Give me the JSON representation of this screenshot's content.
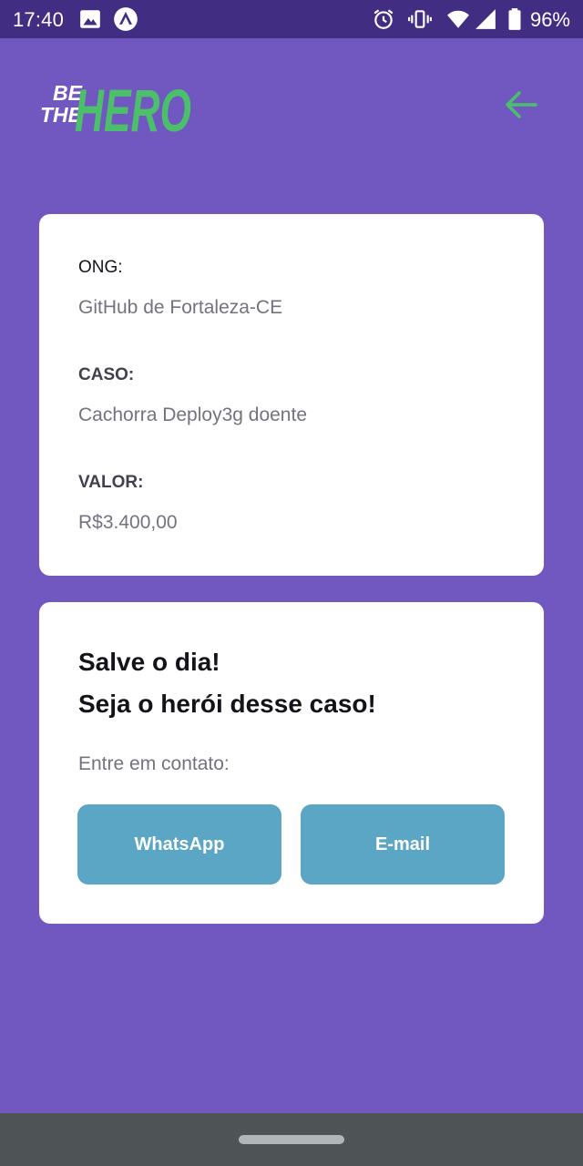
{
  "status_bar": {
    "time": "17:40",
    "battery": "96%",
    "icons": [
      "image-icon",
      "expo-icon",
      "alarm-icon",
      "vibrate-icon",
      "wifi-icon",
      "signal-icon",
      "battery-icon"
    ]
  },
  "header": {
    "logo_text_small_1": "BE",
    "logo_text_small_2": "THE",
    "logo_text_big": "HERO",
    "back_icon": "arrow-left-icon"
  },
  "incident": {
    "ong_label": "ONG:",
    "ong_value": "GitHub de Fortaleza-CE",
    "case_label": "CASO:",
    "case_value": "Cachorra Deploy3g doente",
    "value_label": "VALOR:",
    "value_value": "R$3.400,00"
  },
  "contact": {
    "title_line1": "Salve o dia!",
    "title_line2": "Seja o herói desse caso!",
    "description": "Entre em contato:",
    "whatsapp_label": "WhatsApp",
    "email_label": "E-mail"
  },
  "colors": {
    "background": "#7158c1",
    "status_bar": "#412e82",
    "accent_green": "#4cbf6a",
    "button": "#5ba6c4",
    "nav_bar": "#4e5356"
  }
}
